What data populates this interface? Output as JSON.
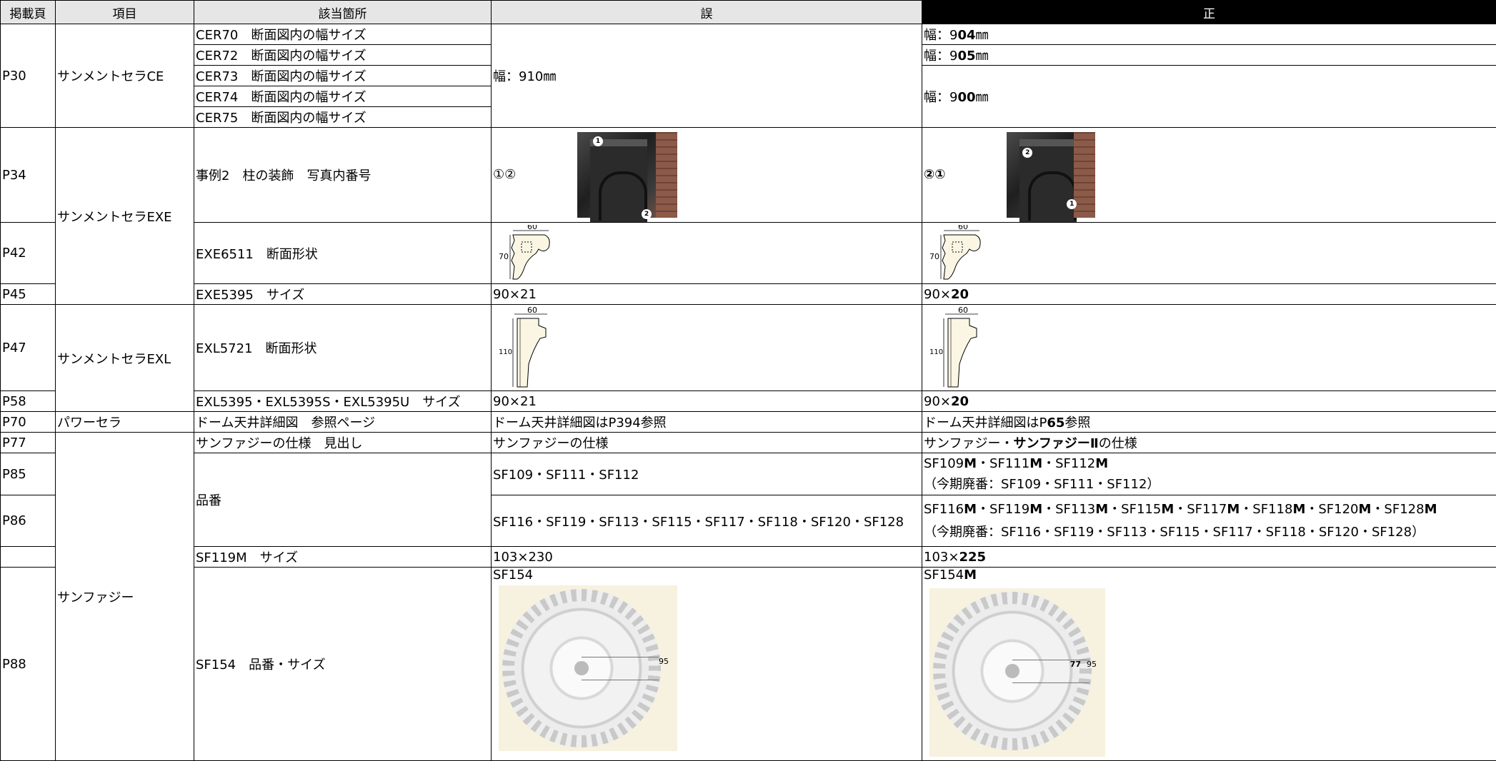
{
  "headers": {
    "page": "掲載頁",
    "item": "項目",
    "location": "該当箇所",
    "wrong": "誤",
    "correct": "正"
  },
  "rows": {
    "p30": {
      "page": "P30",
      "item": "サンメントセラCE",
      "locs": [
        "CER70　断面図内の幅サイズ",
        "CER72　断面図内の幅サイズ",
        "CER73　断面図内の幅サイズ",
        "CER74　断面図内の幅サイズ",
        "CER75　断面図内の幅サイズ"
      ],
      "wrong": "幅：910㎜",
      "c1a": "幅：9",
      "c1b": "04",
      "c1c": "㎜",
      "c2a": "幅：9",
      "c2b": "05",
      "c2c": "㎜",
      "c3a": "幅：9",
      "c3b": "00",
      "c3c": "㎜"
    },
    "p34": {
      "page": "P34",
      "loc": "事例2　柱の装飾　写真内番号",
      "wrong": "①②",
      "correct": "②①",
      "w_b1": "1",
      "w_b2": "2",
      "c_b1": "2",
      "c_b2": "1"
    },
    "exe_item": "サンメントセラEXE",
    "p42": {
      "page": "P42",
      "loc": "EXE6511　断面形状",
      "dim_w": "60",
      "dim_h": "70"
    },
    "p45": {
      "page": "P45",
      "loc": "EXE5395　サイズ",
      "wrong": "90×21",
      "c_a": "90×",
      "c_b": "20"
    },
    "p47": {
      "page": "P47",
      "item": "サンメントセラEXL",
      "loc": "EXL5721　断面形状",
      "dim_w": "60",
      "dim_h": "110"
    },
    "p58": {
      "page": "P58",
      "loc": "EXL5395・EXL5395S・EXL5395U　サイズ",
      "wrong": "90×21",
      "c_a": "90×",
      "c_b": "20"
    },
    "p70": {
      "page": "P70",
      "item": "パワーセラ",
      "loc": "ドーム天井詳細図　参照ページ",
      "wrong": "ドーム天井詳細図はP394参照",
      "c_a": "ドーム天井詳細図はP",
      "c_b": "65",
      "c_c": "参照"
    },
    "p77": {
      "page": "P77",
      "loc": "サンファジーの仕様　見出し",
      "wrong": "サンファジーの仕様",
      "c_a": "サンファジー・",
      "c_b": "サンファジーⅡ",
      "c_c": "の仕様"
    },
    "hinban": "品番",
    "p85": {
      "page": "P85",
      "wrong": "SF109・SF111・SF112",
      "c_line1": [
        "SF109",
        "M",
        "・SF111",
        "M",
        "・SF112",
        "M"
      ],
      "c_line2": "（今期廃番：SF109・SF111・SF112）"
    },
    "p86": {
      "page": "P86",
      "wrong": "SF116・SF119・SF113・SF115・SF117・SF118・SF120・SF128",
      "c_line1": [
        "SF116",
        "M",
        "・SF119",
        "M",
        "・SF113",
        "M",
        "・SF115",
        "M",
        "・SF117",
        "M",
        "・SF118",
        "M",
        "・SF120",
        "M",
        "・SF128",
        "M"
      ],
      "c_line2": "（今期廃番：SF116・SF119・SF113・SF115・SF117・SF118・SF120・SF128）"
    },
    "sf119": {
      "loc": "SF119M　サイズ",
      "wrong": "103×230",
      "c_a": "103×",
      "c_b": "225"
    },
    "sunfuzzy_item": "サンファジー",
    "p88": {
      "page": "P88",
      "loc": "SF154　品番・サイズ",
      "wrong": "SF154",
      "c_a": "SF154",
      "c_b": "M",
      "w_dim": "95",
      "c_dim1": "77",
      "c_dim2": "95"
    }
  }
}
